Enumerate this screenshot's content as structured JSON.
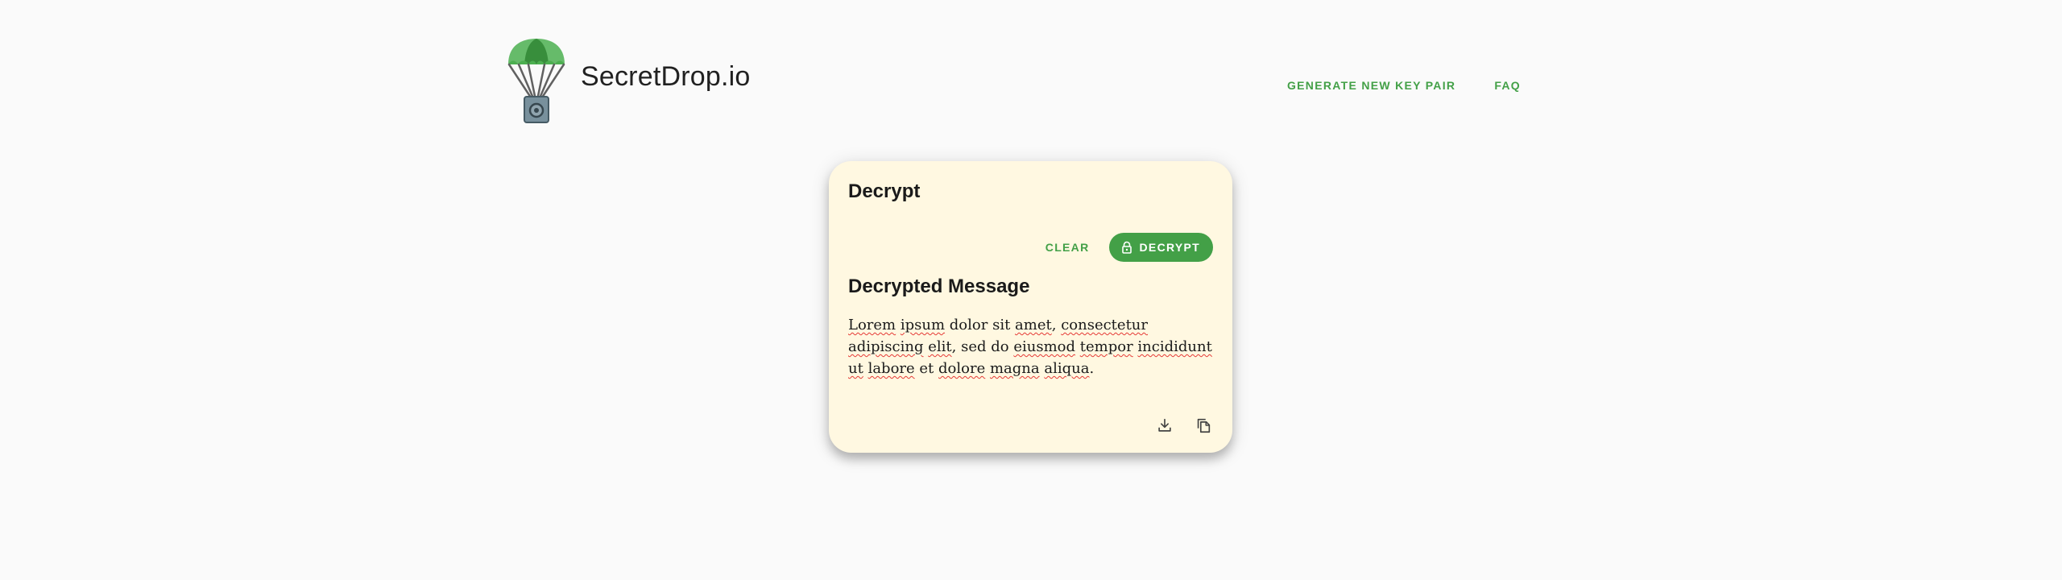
{
  "header": {
    "brand": "SecretDrop.io",
    "logo_icon": "parachute-safe-icon",
    "nav": [
      {
        "label": "GENERATE NEW KEY PAIR"
      },
      {
        "label": "FAQ"
      }
    ]
  },
  "card": {
    "title": "Decrypt",
    "clear_label": "CLEAR",
    "decrypt_label": "DECRYPT",
    "decrypt_icon": "lock-open-icon",
    "section_title": "Decrypted Message",
    "message_text": "Lorem ipsum dolor sit amet, consectetur adipiscing elit, sed do eiusmod tempor incididunt ut labore et dolore magna aliqua.",
    "download_icon": "download-icon",
    "copy_icon": "copy-icon",
    "background": "#fff8e1"
  },
  "colors": {
    "accent": "#43a047",
    "page_background": "#fafafa"
  }
}
